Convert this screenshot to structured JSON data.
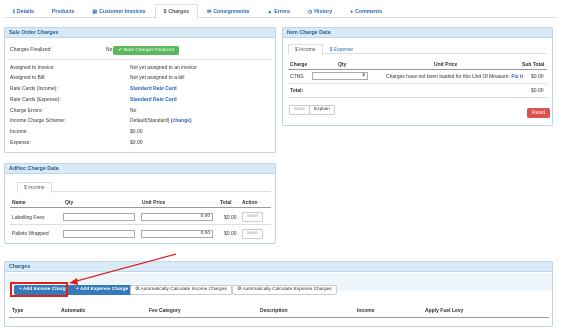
{
  "tabs": [
    {
      "label": "Details",
      "icon": "info-icon",
      "glyph": "ℹ"
    },
    {
      "label": "Products",
      "icon": "",
      "glyph": ""
    },
    {
      "label": "Customer Invoices",
      "icon": "document-icon",
      "glyph": "▤"
    },
    {
      "label": "Charges",
      "icon": "dollar-icon",
      "glyph": "$"
    },
    {
      "label": "Consignments",
      "icon": "envelope-icon",
      "glyph": "✉"
    },
    {
      "label": "Errors",
      "icon": "warning-icon",
      "glyph": "▲"
    },
    {
      "label": "History",
      "icon": "clock-icon",
      "glyph": "◷"
    },
    {
      "label": "Comments",
      "icon": "comment-icon",
      "glyph": "●"
    }
  ],
  "active_tab": "Charges",
  "sale_order": {
    "title": "Sale Order Charges",
    "charges_finalized_label": "Charges Finalized:",
    "charges_finalized_value": "No",
    "mark_button": "Mark Charges Finalized",
    "rows": [
      {
        "key": "Assigned to Invoice:",
        "value": "Not yet assigned to an invoice",
        "link": false
      },
      {
        "key": "Assigned to Bill:",
        "value": "Not yet assigned to a bill",
        "link": false
      },
      {
        "key": "Rate Cards (Income):",
        "value": "Standard Rate Card",
        "link": true
      },
      {
        "key": "Rate Cards (Expense):",
        "value": "Standard Rate Card",
        "link": true
      },
      {
        "key": "Charge Errors:",
        "value": "No",
        "link": false
      },
      {
        "key": "Income Charge Scheme:",
        "value": "Default(Standard)",
        "link": false,
        "extra": "(change)"
      },
      {
        "key": "Income:",
        "value": "$0.00",
        "link": false
      },
      {
        "key": "Expense:",
        "value": "$0.00",
        "link": false
      }
    ]
  },
  "item_charge": {
    "title": "Item Charge Data",
    "tabs": [
      "$ Income",
      "$ Expense"
    ],
    "columns": [
      "Charge",
      "Qty",
      "Unit Price",
      "Sub Total"
    ],
    "row": {
      "charge": "CTNS",
      "qty_suffix": "$",
      "unit_price_msg": "Charges have not been loaded for this Unit Of Measure:",
      "fix_link": "Fix it",
      "sub_total": "$0.00"
    },
    "total_label": "Total:",
    "total_value": "$0.00",
    "save_button": "Save",
    "explain_button": "Explain",
    "reset_button": "Reset"
  },
  "adhoc": {
    "title": "AdHoc Charge Data",
    "tab": "$ Income",
    "columns": [
      "Name",
      "Qty",
      "Unit Price",
      "Total",
      "Action"
    ],
    "rows": [
      {
        "name": "Labelling Fees",
        "unit_price": "0.00",
        "total": "$0.00",
        "action": "Save"
      },
      {
        "name": "Pallets Wrapped",
        "unit_price": "0.00",
        "total": "$0.00",
        "action": "Save"
      }
    ]
  },
  "charges": {
    "title": "Charges",
    "add_income": "+ Add Income Charge",
    "add_expense": "+ Add Expense Charge",
    "auto_income": "Automatically Calculate Income Charges",
    "auto_expense": "Automatically Calculate Expense Charges",
    "columns": [
      "Type",
      "Automatic",
      "Fee Category",
      "Description",
      "Income",
      "Apply Fuel Levy"
    ]
  },
  "colors": {
    "link": "#2a6ab5",
    "panel_head": "#d9e9f5",
    "green": "#5cb85c",
    "blue": "#337ab7",
    "red": "#d9534f",
    "highlight": "#e0201a"
  }
}
